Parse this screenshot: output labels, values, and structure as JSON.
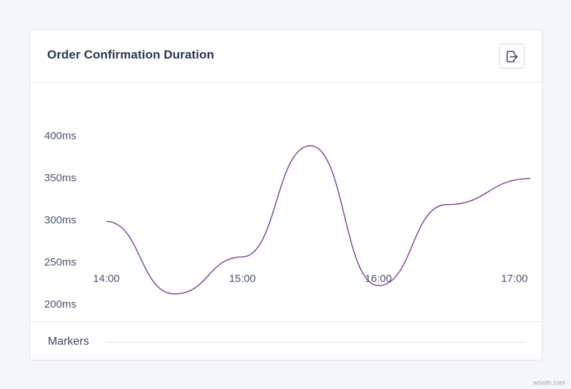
{
  "card": {
    "title": "Order Confirmation Duration",
    "export_icon": "export-icon"
  },
  "markers": {
    "label": "Markers"
  },
  "watermark": "wsxdn.com",
  "colors": {
    "line": "#7b3a96",
    "background": "#f5f6f9",
    "card": "#ffffff",
    "border": "#e0e3ea"
  },
  "chart_data": {
    "type": "line",
    "title": "Order Confirmation Duration",
    "xlabel": "",
    "ylabel": "",
    "x_tick_labels": [
      "14:00",
      "15:00",
      "16:00",
      "17:00"
    ],
    "y_tick_labels": [
      "200ms",
      "250ms",
      "300ms",
      "350ms",
      "400ms"
    ],
    "y_ticks": [
      200,
      250,
      300,
      350,
      400
    ],
    "ylim": [
      200,
      400
    ],
    "x_unit": "minutes from 14:00",
    "xlim": [
      0,
      187
    ],
    "grid": false,
    "legend": "none",
    "series": [
      {
        "values": [
          {
            "x": 0,
            "y": 298
          },
          {
            "x": 30,
            "y": 212
          },
          {
            "x": 60,
            "y": 256
          },
          {
            "x": 90,
            "y": 388
          },
          {
            "x": 120,
            "y": 222
          },
          {
            "x": 150,
            "y": 318
          },
          {
            "x": 187,
            "y": 349
          }
        ]
      }
    ]
  }
}
